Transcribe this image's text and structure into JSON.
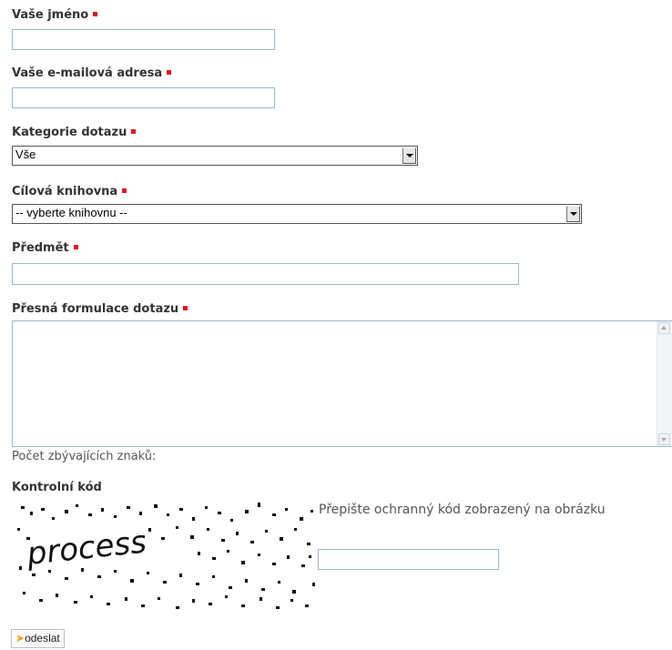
{
  "form": {
    "name_label": "Vaše jméno",
    "email_label": "Vaše e-mailová adresa",
    "category_label": "Kategorie dotazu",
    "category_selected": "Vše",
    "library_label": "Cílová knihovna",
    "library_selected": "-- vyberte knihovnu --",
    "subject_label": "Předmět",
    "question_label": "Přesná formulace dotazu",
    "remaining_chars_label": "Počet zbývajících znaků:",
    "captcha_label": "Kontrolní kód",
    "captcha_word": "process",
    "captcha_instruction": "Přepište ochranný kód zobrazený na obrázku",
    "submit_label": "odeslat"
  },
  "icons": {
    "required_marker": "required-square-icon",
    "select_arrow": "chevron-down-icon",
    "submit_icon": "arrow-icon"
  },
  "colors": {
    "required": "#e8141e",
    "field_border": "#9fb5cc",
    "text": "#333333"
  }
}
